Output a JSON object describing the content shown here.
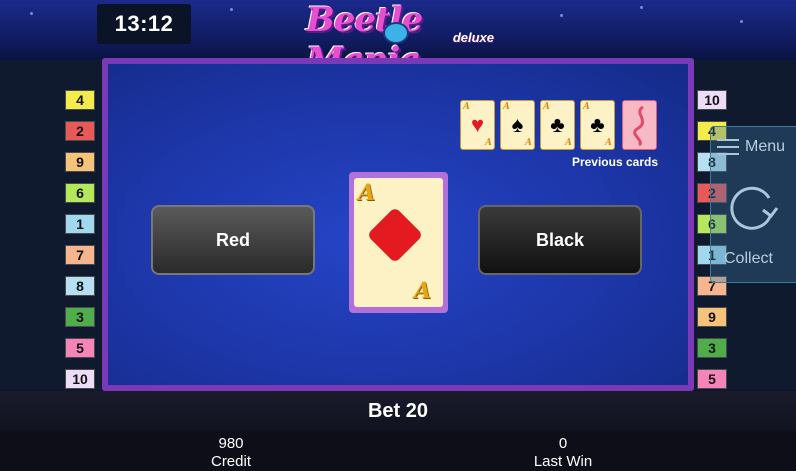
{
  "header": {
    "clock": "13:12",
    "logo_main": "Beetle Mania",
    "logo_sub": "deluxe"
  },
  "left_numbers": [
    "4",
    "2",
    "9",
    "6",
    "1",
    "7",
    "8",
    "3",
    "5",
    "10"
  ],
  "right_numbers": [
    "10",
    "4",
    "8",
    "2",
    "6",
    "1",
    "7",
    "9",
    "3",
    "5"
  ],
  "number_colors": {
    "1": "#9fd8ef",
    "2": "#e8595a",
    "3": "#4fae4a",
    "4": "#f3ea4c",
    "5": "#f585b8",
    "6": "#b3e85a",
    "7": "#f6b58f",
    "8": "#b7dff3",
    "9": "#f6c37a",
    "10": "#ecdcf8"
  },
  "gamble": {
    "red_label": "Red",
    "black_label": "Black",
    "current_card": {
      "rank": "A",
      "suit": "diamond"
    },
    "previous_label": "Previous cards",
    "previous_cards": [
      {
        "rank": "A",
        "suit": "♥",
        "color": "#e31b20"
      },
      {
        "rank": "A",
        "suit": "♠",
        "color": "#000000"
      },
      {
        "rank": "A",
        "suit": "♣",
        "color": "#000000"
      },
      {
        "rank": "A",
        "suit": "♣",
        "color": "#000000"
      }
    ]
  },
  "side_menu": {
    "menu_label": "Menu",
    "collect_label": "Collect"
  },
  "footer": {
    "bet": "Bet 20",
    "credit_value": "980",
    "credit_label": "Credit",
    "last_win_value": "0",
    "last_win_label": "Last Win"
  }
}
